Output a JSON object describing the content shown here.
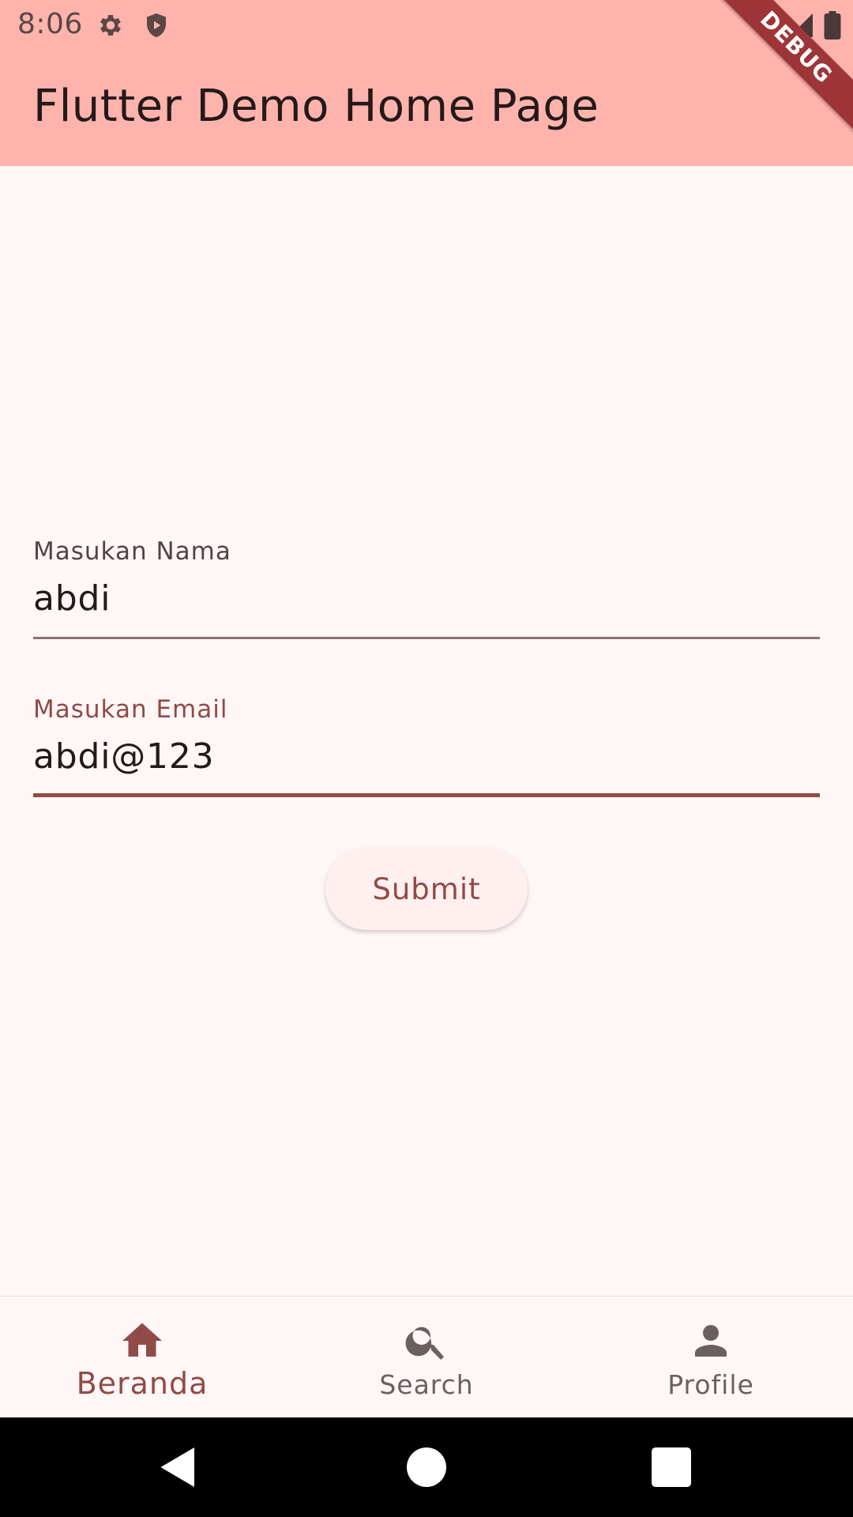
{
  "status_bar": {
    "time": "8:06",
    "left_icons": [
      "gear-icon",
      "shield-icon"
    ],
    "right_icons": [
      "wifi-icon",
      "signal-icon",
      "battery-icon"
    ]
  },
  "app_bar": {
    "title": "Flutter Demo Home Page",
    "debug_banner": "DEBUG",
    "background_color": "#ffb3ad"
  },
  "form": {
    "name_field": {
      "label": "Masukan Nama",
      "value": "abdi"
    },
    "email_field": {
      "label": "Masukan Email",
      "value": "abdi@123",
      "focused": true
    },
    "submit_label": "Submit"
  },
  "bottom_nav": {
    "items": [
      {
        "label": "Beranda",
        "icon": "home-icon",
        "active": true
      },
      {
        "label": "Search",
        "icon": "search-icon",
        "active": false
      },
      {
        "label": "Profile",
        "icon": "person-icon",
        "active": false
      }
    ]
  },
  "system_nav": {
    "buttons": [
      "back-icon",
      "home-circle-icon",
      "recents-icon"
    ]
  },
  "colors": {
    "accent": "#904a48",
    "background": "#fff7f6"
  }
}
